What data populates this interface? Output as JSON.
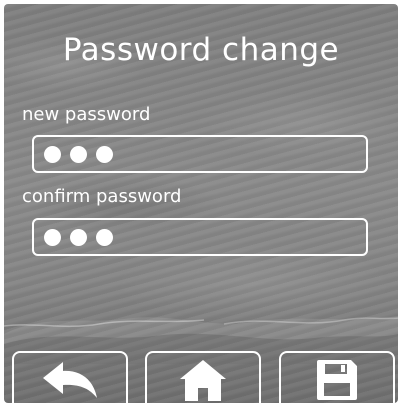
{
  "screen": {
    "title": "Password change"
  },
  "fields": {
    "new_password": {
      "label": "new password",
      "masked_dots": 3
    },
    "confirm_password": {
      "label": "confirm password",
      "masked_dots": 3
    }
  },
  "toolbar": {
    "buttons": [
      {
        "icon": "back-arrow-icon"
      },
      {
        "icon": "home-icon"
      },
      {
        "icon": "save-floppy-icon"
      }
    ]
  },
  "colors": {
    "foreground": "#ffffff",
    "background": "#808080"
  }
}
